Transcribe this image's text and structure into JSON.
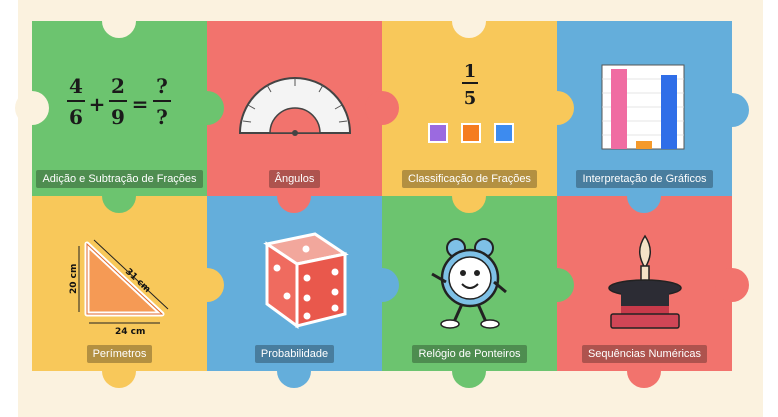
{
  "colors": {
    "green": "#6cc46f",
    "red": "#f2736d",
    "yellow": "#f8c85a",
    "blue": "#64aedb",
    "background": "#fbf2df"
  },
  "tiles": [
    {
      "label": "Adição e Subtração de Frações",
      "icon": "fraction-equation-icon"
    },
    {
      "label": "Ângulos",
      "icon": "protractor-icon"
    },
    {
      "label": "Classificação de Frações",
      "icon": "fraction-blocks-icon"
    },
    {
      "label": "Interpretação de Gráficos",
      "icon": "bar-chart-icon"
    },
    {
      "label": "Perímetros",
      "icon": "triangle-icon"
    },
    {
      "label": "Probabilidade",
      "icon": "dice-icon"
    },
    {
      "label": "Relógio de Ponteiros",
      "icon": "alarm-clock-icon"
    },
    {
      "label": "Sequências Numéricas",
      "icon": "magic-hat-icon"
    }
  ],
  "fraction_art": {
    "n1": "4",
    "d1": "6",
    "op": "+",
    "n2": "2",
    "d2": "9",
    "eq": "=",
    "n3": "?",
    "d3": "?"
  },
  "classify_art": {
    "num": "1",
    "den": "5"
  },
  "triangle_art": {
    "side_a": "20 cm",
    "side_b": "31 cm",
    "side_c": "24 cm"
  }
}
